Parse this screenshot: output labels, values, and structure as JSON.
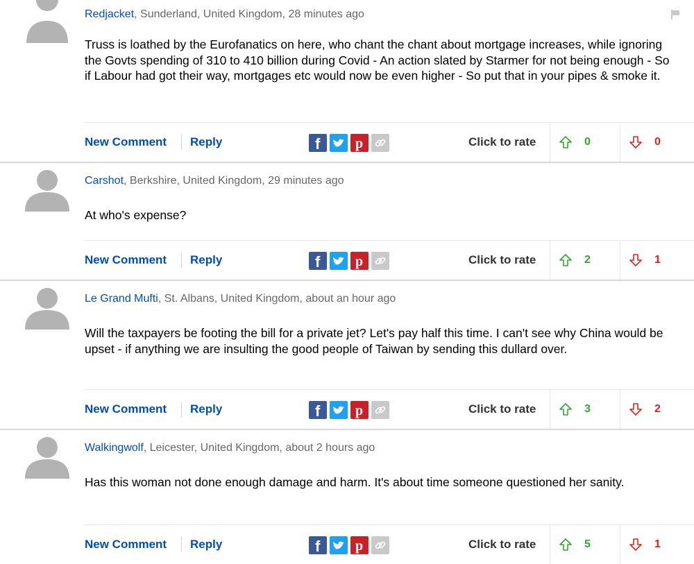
{
  "actions": {
    "new_comment": "New Comment",
    "reply": "Reply",
    "rate_label": "Click to rate"
  },
  "share_icons": [
    "facebook-icon",
    "twitter-icon",
    "pinterest-icon",
    "link-icon"
  ],
  "colors": {
    "link_blue": "#004db3",
    "vote_up": "#2ea82e",
    "vote_down": "#e02020",
    "facebook": "#3b5998",
    "twitter": "#1da1f2",
    "pinterest": "#cb2027"
  },
  "comments": [
    {
      "author": "Redjacket",
      "location": ", Sunderland, United Kingdom, 28 minutes ago",
      "text": "Truss is loathed by the Eurofanatics on here, who chant the chant about mortgage increases, while ignoring the Govts spending of 310 to 410 billion during Covid - An action slated by Starmer for not being enough - So if Labour had got their way, mortgages etc would now be even higher - So put that in your pipes & smoke it.",
      "up": "0",
      "down": "0"
    },
    {
      "author": "Carshot",
      "location": ", Berkshire, United Kingdom, 29 minutes ago",
      "text": "At who's expense?",
      "up": "2",
      "down": "1"
    },
    {
      "author": "Le Grand Mufti",
      "location": ", St. Albans, United Kingdom, about an hour ago",
      "text": "Will the taxpayers be footing the bill for a private jet? Let's pay half this time. I can't see why China would be upset - if anything we are insulting the good people of Taiwan by sending this dullard over.",
      "up": "3",
      "down": "2"
    },
    {
      "author": "Walkingwolf",
      "location": ", Leicester, United Kingdom, about 2 hours ago",
      "text": "Has this woman not done enough damage and harm. It's about time someone questioned her sanity.",
      "up": "5",
      "down": "1"
    }
  ]
}
